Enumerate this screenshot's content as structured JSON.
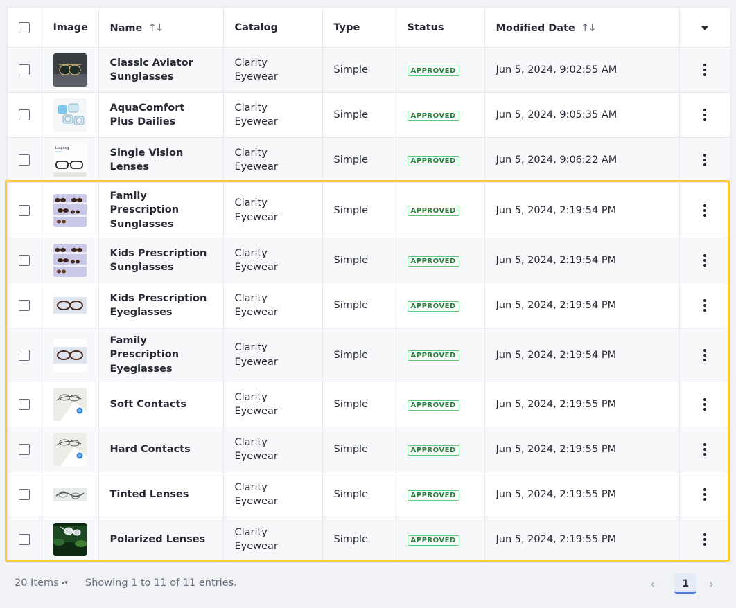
{
  "table": {
    "headers": {
      "image": "Image",
      "name": "Name",
      "catalog": "Catalog",
      "type": "Type",
      "status": "Status",
      "modified": "Modified Date"
    },
    "rows": [
      {
        "name": "Classic Aviator Sunglasses",
        "catalog": "Clarity Eyewear",
        "type": "Simple",
        "status": "APPROVED",
        "modified": "Jun 5, 2024, 9:02:55 AM",
        "thumb": "aviator"
      },
      {
        "name": "AquaComfort Plus Dailies",
        "catalog": "Clarity Eyewear",
        "type": "Simple",
        "status": "APPROVED",
        "modified": "Jun 5, 2024, 9:05:35 AM",
        "thumb": "contacts-blister"
      },
      {
        "name": "Single Vision Lenses",
        "catalog": "Clarity Eyewear",
        "type": "Simple",
        "status": "APPROVED",
        "modified": "Jun 5, 2024, 9:06:22 AM",
        "thumb": "glasses-white"
      },
      {
        "name": "Family Prescription Sunglasses",
        "catalog": "Clarity Eyewear",
        "type": "Simple",
        "status": "APPROVED",
        "modified": "Jun 5, 2024, 2:19:54 PM",
        "thumb": "sunglasses-row"
      },
      {
        "name": "Kids Prescription Sunglasses",
        "catalog": "Clarity Eyewear",
        "type": "Simple",
        "status": "APPROVED",
        "modified": "Jun 5, 2024, 2:19:54 PM",
        "thumb": "sunglasses-row"
      },
      {
        "name": "Kids Prescription Eyeglasses",
        "catalog": "Clarity Eyewear",
        "type": "Simple",
        "status": "APPROVED",
        "modified": "Jun 5, 2024, 2:19:54 PM",
        "thumb": "eyeglasses"
      },
      {
        "name": "Family Prescription Eyeglasses",
        "catalog": "Clarity Eyewear",
        "type": "Simple",
        "status": "APPROVED",
        "modified": "Jun 5, 2024, 2:19:54 PM",
        "thumb": "eyeglasses"
      },
      {
        "name": "Soft Contacts",
        "catalog": "Clarity Eyewear",
        "type": "Simple",
        "status": "APPROVED",
        "modified": "Jun 5, 2024, 2:19:55 PM",
        "thumb": "contacts-case"
      },
      {
        "name": "Hard Contacts",
        "catalog": "Clarity Eyewear",
        "type": "Simple",
        "status": "APPROVED",
        "modified": "Jun 5, 2024, 2:19:55 PM",
        "thumb": "contacts-case"
      },
      {
        "name": "Tinted Lenses",
        "catalog": "Clarity Eyewear",
        "type": "Simple",
        "status": "APPROVED",
        "modified": "Jun 5, 2024, 2:19:55 PM",
        "thumb": "lens-flat"
      },
      {
        "name": "Polarized Lenses",
        "catalog": "Clarity Eyewear",
        "type": "Simple",
        "status": "APPROVED",
        "modified": "Jun 5, 2024, 2:19:55 PM",
        "thumb": "polarized-green"
      }
    ]
  },
  "footer": {
    "items_per_page": "20 Items",
    "showing": "Showing 1 to 11 of 11 entries.",
    "current_page": "1"
  },
  "colors": {
    "approved_text": "#287d3c",
    "approved_border": "#5aca75",
    "highlight": "#ffc93c",
    "page_active": "#4b7be5"
  }
}
